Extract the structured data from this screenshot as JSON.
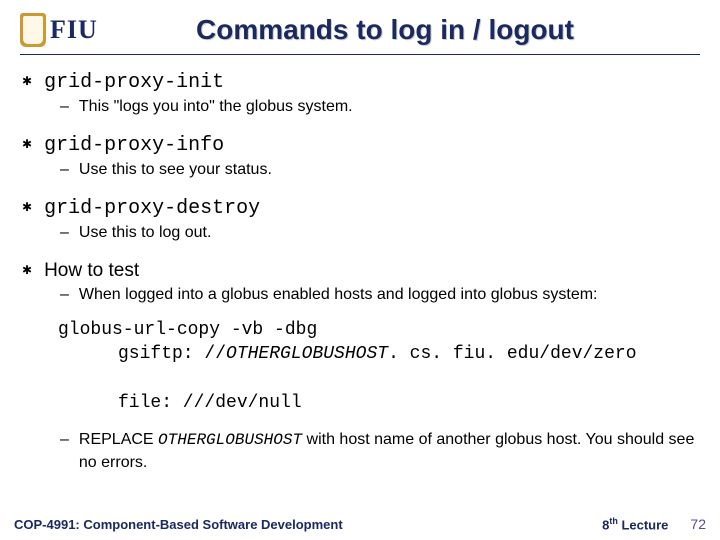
{
  "header": {
    "logo_text": "FIU",
    "title": "Commands to log in / logout"
  },
  "bullets": [
    {
      "command": "grid-proxy-init",
      "command_is_code": true,
      "description": "This \"logs you into\" the globus system."
    },
    {
      "command": "grid-proxy-info",
      "command_is_code": true,
      "description": "Use this to see your status."
    },
    {
      "command": "grid-proxy-destroy",
      "command_is_code": true,
      "description": "Use this to log out."
    },
    {
      "command": "How to test",
      "command_is_code": false,
      "description": "When logged into a globus enabled hosts and logged into globus system:"
    }
  ],
  "code_example": {
    "line1": "globus-url-copy -vb -dbg",
    "line2_prefix": "gsiftp: //",
    "line2_host": "OTHERGLOBUSHOST",
    "line2_suffix": ". cs. fiu. edu/dev/zero",
    "line3": "file: ///dev/null"
  },
  "replace_note": {
    "prefix": "REPLACE ",
    "host": "OTHERGLOBUSHOST",
    "suffix": " with host name of another globus host. You should see no errors."
  },
  "footer": {
    "course": "COP-4991: Component-Based Software Development",
    "lecture_ord": "8",
    "lecture_sup": "th",
    "lecture_word": " Lecture",
    "page": "72"
  }
}
